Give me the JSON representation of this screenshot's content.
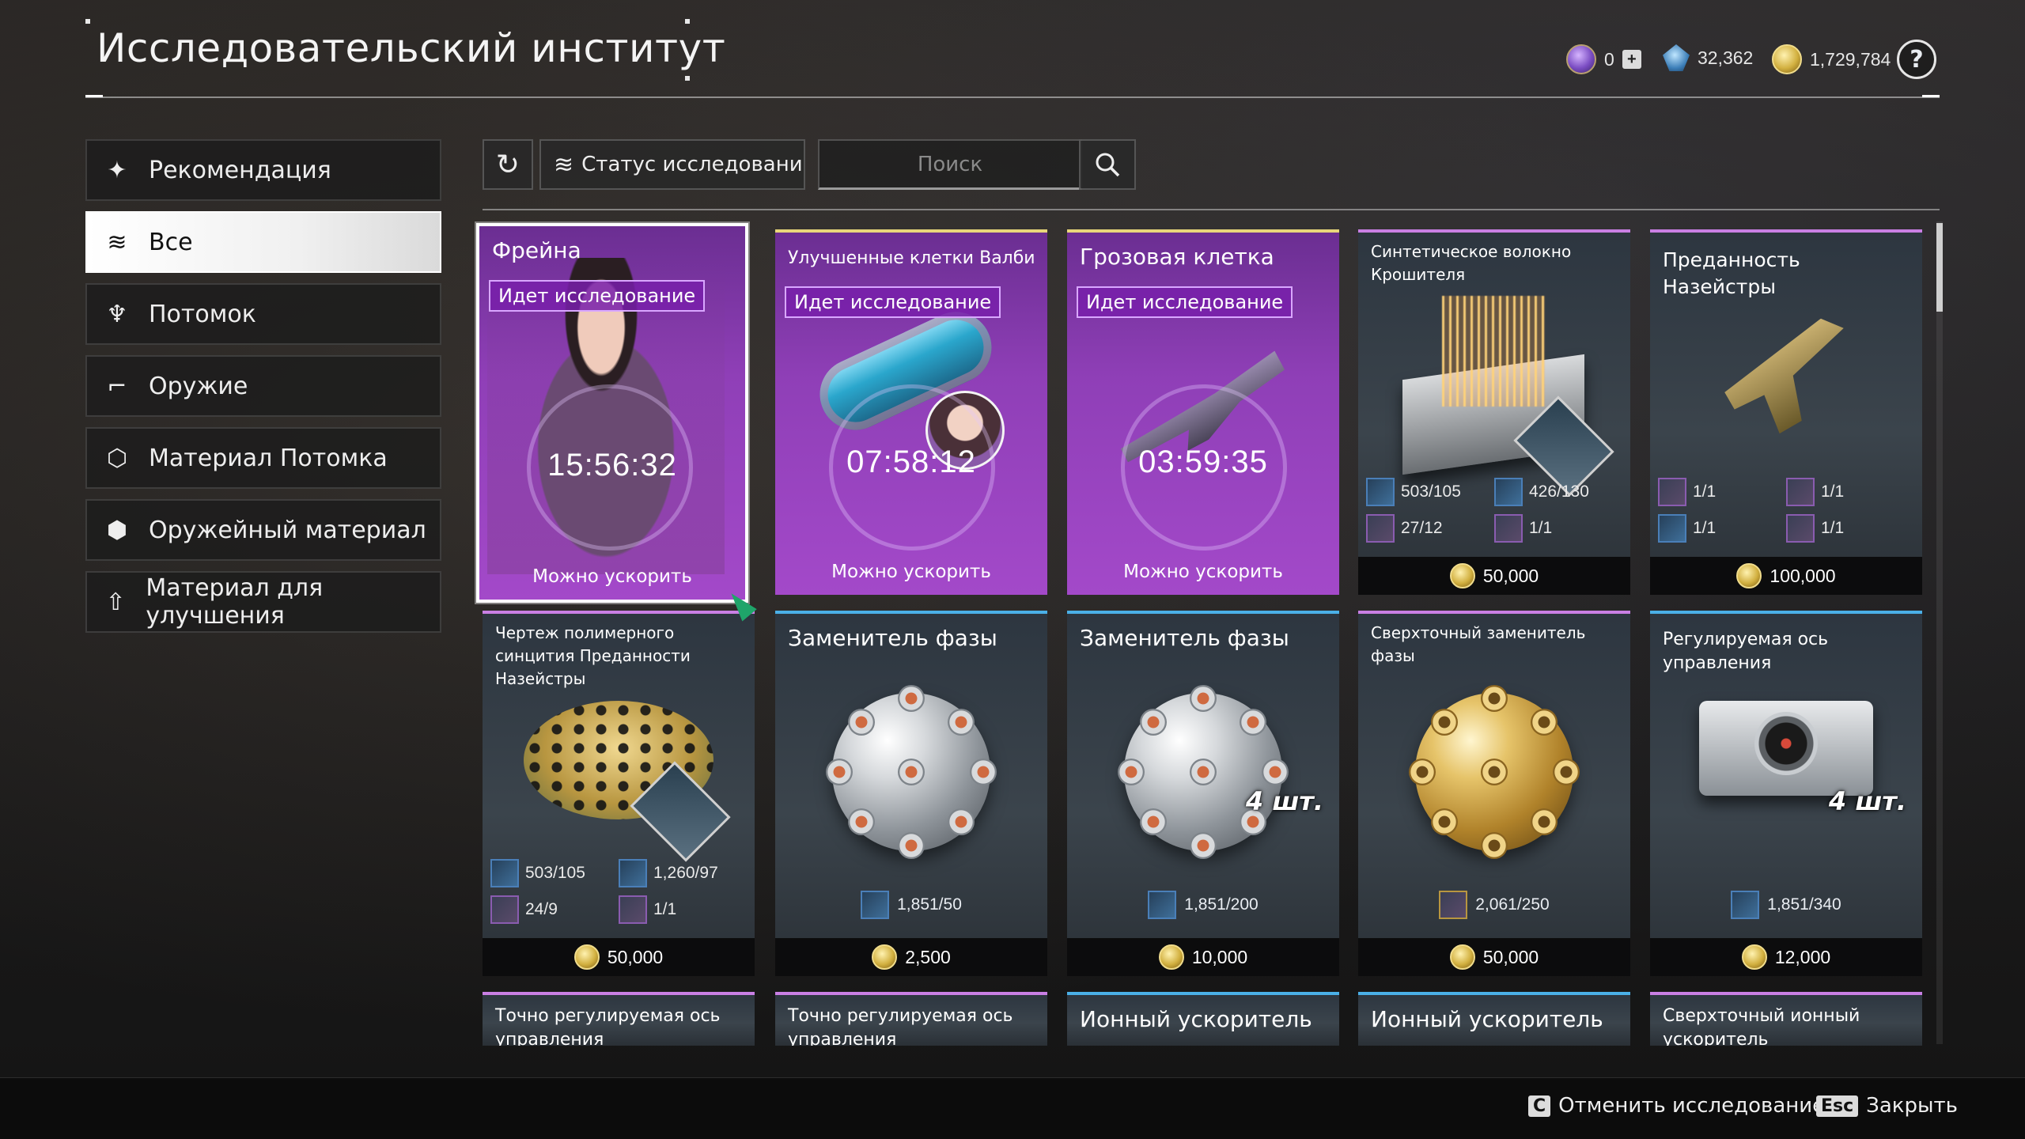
{
  "header": {
    "title": "Исследовательский институт"
  },
  "currencies": [
    {
      "name": "caliber-icon",
      "value": "0"
    },
    {
      "name": "kuiper-shard-icon",
      "value": "32,362"
    },
    {
      "name": "gold-coin-icon",
      "value": "1,729,784"
    }
  ],
  "help_label": "?",
  "sidebar": {
    "items": [
      {
        "label": "Рекомендация",
        "icon": "star-cluster-icon"
      },
      {
        "label": "Все",
        "icon": "layers-icon"
      },
      {
        "label": "Потомок",
        "icon": "descendant-icon"
      },
      {
        "label": "Оружие",
        "icon": "gun-icon"
      },
      {
        "label": "Материал Потомка",
        "icon": "descendant-material-icon"
      },
      {
        "label": "Оружейный материал",
        "icon": "weapon-material-icon"
      },
      {
        "label": "Материал для улучшения",
        "icon": "upgrade-material-icon"
      }
    ],
    "active_index": 1
  },
  "toolbar": {
    "refresh_icon": "↻",
    "status_label": "Статус исследования",
    "search_placeholder": "Поиск",
    "search_icon": "⚲"
  },
  "cards": [
    {
      "title": "Фрейна",
      "badge": "Идет исследование",
      "timer": "15:56:32",
      "boost": "Можно ускорить"
    },
    {
      "title": "Улучшенные клетки Валби",
      "badge": "Идет исследование",
      "timer": "07:58:12",
      "boost": "Можно ускорить"
    },
    {
      "title": "Грозовая клетка",
      "badge": "Идет исследование",
      "timer": "03:59:35",
      "boost": "Можно ускорить"
    },
    {
      "title": "Синтетическое волокно Крошителя",
      "mats": [
        "503/105",
        "426/130",
        "27/12",
        "1/1"
      ],
      "price": "50,000"
    },
    {
      "title": "Преданность Назейстры",
      "mats": [
        "1/1",
        "1/1",
        "1/1",
        "1/1"
      ],
      "price": "100,000"
    },
    {
      "title": "Чертеж полимерного синцития Преданности Назейстры",
      "mats": [
        "503/105",
        "1,260/97",
        "24/9",
        "1/1"
      ],
      "price": "50,000"
    },
    {
      "title": "Заменитель фазы",
      "mat": "1,851/50",
      "price": "2,500"
    },
    {
      "title": "Заменитель фазы",
      "qty": "4 шт.",
      "mat": "1,851/200",
      "price": "10,000"
    },
    {
      "title": "Сверхточный заменитель фазы",
      "mat": "2,061/250",
      "price": "50,000"
    },
    {
      "title": "Регулируемая ось управления",
      "qty": "4 шт.",
      "mat": "1,851/340",
      "price": "12,000"
    },
    {
      "title": "Точно регулируемая ось управления"
    },
    {
      "title": "Точно регулируемая ось управления"
    },
    {
      "title": "Ионный ускоритель"
    },
    {
      "title": "Ионный ускоритель"
    },
    {
      "title": "Сверхточный ионный ускоритель"
    }
  ],
  "footer": {
    "cancel_key": "C",
    "cancel_label": "Отменить исследование",
    "close_key": "Esc",
    "close_label": "Закрыть"
  },
  "colors": {
    "research_purple": "#8f3fb7",
    "badge_border": "#d9a7ff",
    "card_top_purple": "#c97fe4",
    "card_top_blue": "#4ab0e8",
    "gold": "#d2b040"
  }
}
